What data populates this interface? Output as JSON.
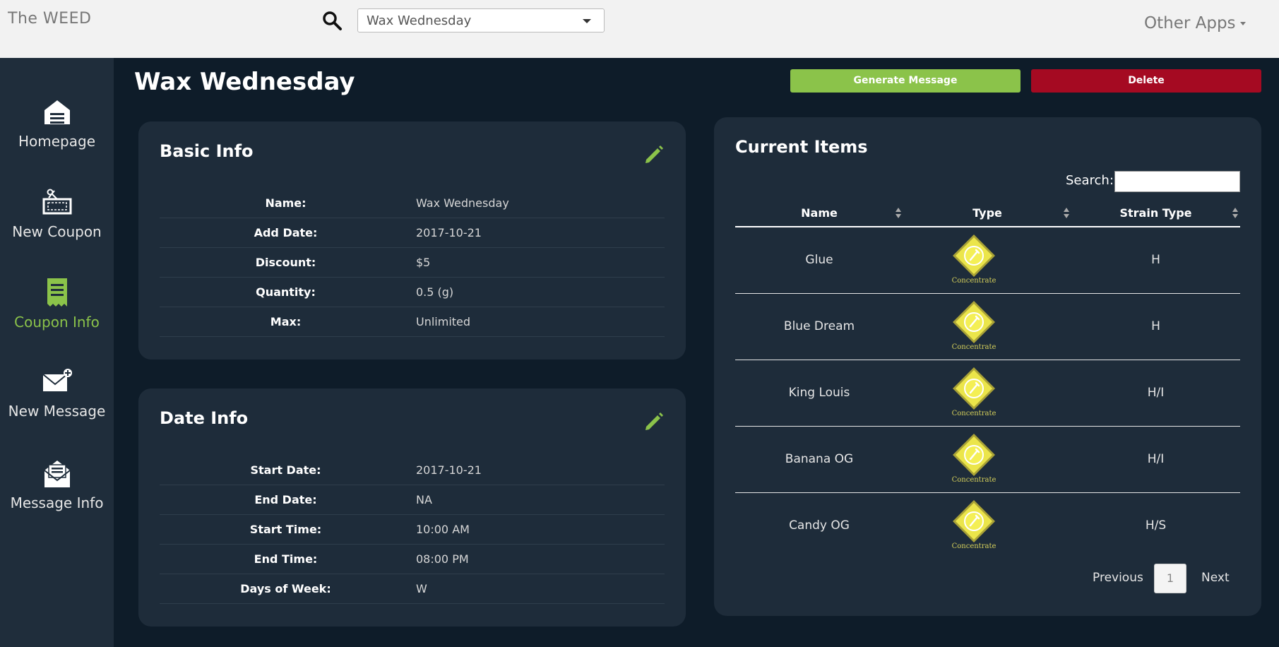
{
  "header": {
    "brand": "The WEED",
    "coupon_select_value": "Wax Wednesday",
    "other_apps_label": "Other Apps"
  },
  "sidebar": {
    "items": [
      {
        "label": "Homepage",
        "icon": "store-icon"
      },
      {
        "label": "New Coupon",
        "icon": "coupon-icon"
      },
      {
        "label": "Coupon Info",
        "icon": "receipt-icon"
      },
      {
        "label": "New Message",
        "icon": "envelope-plus-icon"
      },
      {
        "label": "Message Info",
        "icon": "envelope-open-icon"
      }
    ],
    "active_index": 2
  },
  "main": {
    "title": "Wax Wednesday",
    "generate_label": "Generate Message",
    "delete_label": "Delete"
  },
  "basic_info": {
    "title": "Basic Info",
    "rows": [
      {
        "key": "Name:",
        "value": "Wax Wednesday"
      },
      {
        "key": "Add Date:",
        "value": "2017-10-21"
      },
      {
        "key": "Discount:",
        "value": "$5"
      },
      {
        "key": "Quantity:",
        "value": "0.5 (g)"
      },
      {
        "key": "Max:",
        "value": "Unlimited"
      }
    ]
  },
  "date_info": {
    "title": "Date Info",
    "rows": [
      {
        "key": "Start Date:",
        "value": "2017-10-21"
      },
      {
        "key": "End Date:",
        "value": "NA"
      },
      {
        "key": "Start Time:",
        "value": "10:00 AM"
      },
      {
        "key": "End Time:",
        "value": "08:00 PM"
      },
      {
        "key": "Days of Week:",
        "value": "W"
      }
    ]
  },
  "current_items": {
    "title": "Current Items",
    "search_label": "Search:",
    "columns": [
      "Name",
      "Type",
      "Strain Type"
    ],
    "rows": [
      {
        "name": "Glue",
        "type": "Concentrate",
        "strain": "H"
      },
      {
        "name": "Blue Dream",
        "type": "Concentrate",
        "strain": "H"
      },
      {
        "name": "King Louis",
        "type": "Concentrate",
        "strain": "H/I"
      },
      {
        "name": "Banana OG",
        "type": "Concentrate",
        "strain": "H/I"
      },
      {
        "name": "Candy OG",
        "type": "Concentrate",
        "strain": "H/S"
      }
    ],
    "pager": {
      "previous": "Previous",
      "current": "1",
      "next": "Next"
    }
  },
  "colors": {
    "accent_green": "#8bc34a",
    "danger_red": "#a50a22",
    "background": "#0e1c29",
    "card": "#1e2c3a",
    "sidebar": "#1f2d3b"
  }
}
